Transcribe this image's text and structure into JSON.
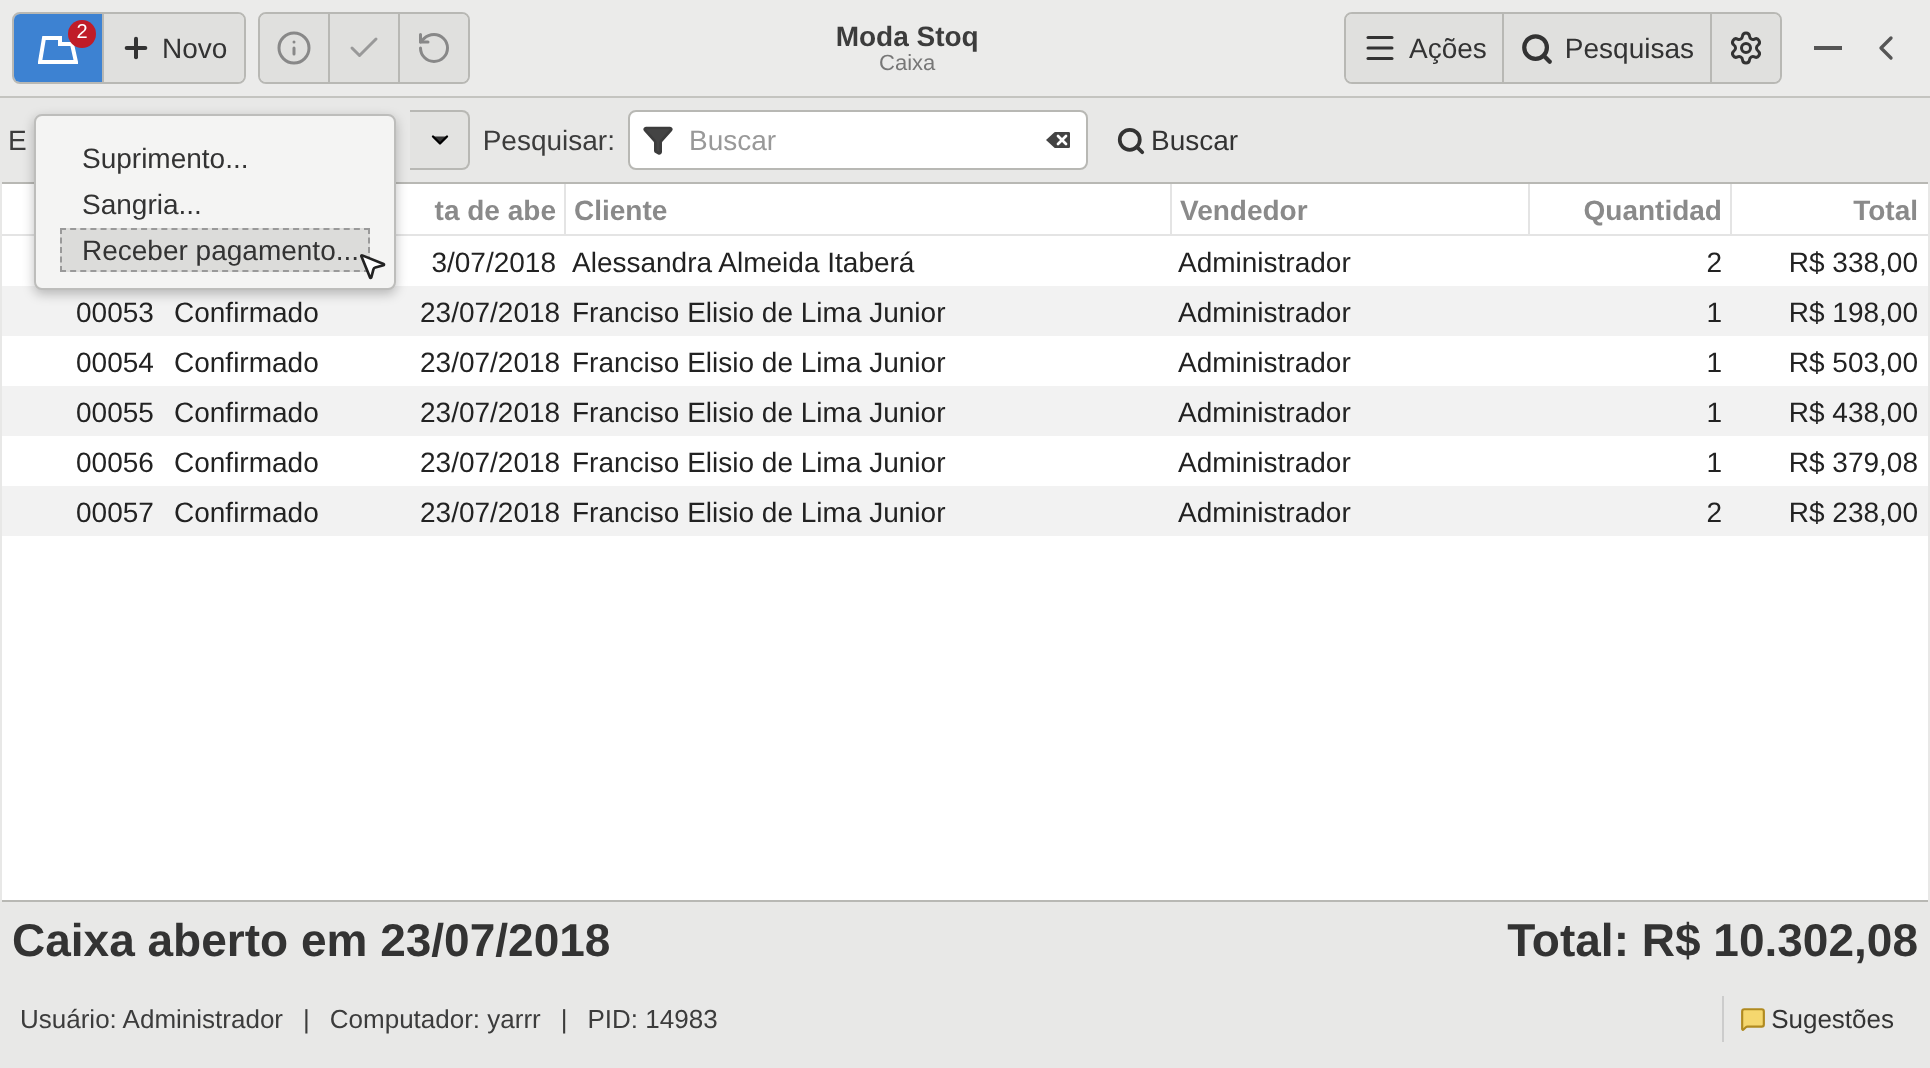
{
  "header": {
    "badge": "2",
    "new_button": "Novo",
    "title": "Moda Stoq",
    "subtitle": "Caixa",
    "actions_button": "Ações",
    "searches_button": "Pesquisas"
  },
  "filter": {
    "label": "E",
    "search_label": "Pesquisar:",
    "placeholder": "Buscar",
    "search_button": "Buscar"
  },
  "menu": {
    "items": [
      {
        "label": "Suprimento...",
        "selected": false
      },
      {
        "label": "Sangria...",
        "selected": false
      },
      {
        "label": "Receber pagamento...",
        "selected": true
      }
    ]
  },
  "table": {
    "columns": [
      {},
      {},
      {
        "label": "ta de abe"
      },
      {
        "label": "Cliente"
      },
      {
        "label": "Vendedor"
      },
      {
        "label": "Quantidad"
      },
      {
        "label": "Total"
      }
    ],
    "rows": [
      {
        "cells": [
          null,
          null,
          "3/07/2018",
          "Alessandra Almeida Itaberá",
          "Administrador",
          "2",
          "R$ 338,00"
        ]
      },
      {
        "cells": [
          "00053",
          "Confirmado",
          "23/07/2018",
          "Franciso Elisio de Lima Junior",
          "Administrador",
          "1",
          "R$ 198,00"
        ]
      },
      {
        "cells": [
          "00054",
          "Confirmado",
          "23/07/2018",
          "Franciso Elisio de Lima Junior",
          "Administrador",
          "1",
          "R$ 503,00"
        ]
      },
      {
        "cells": [
          "00055",
          "Confirmado",
          "23/07/2018",
          "Franciso Elisio de Lima Junior",
          "Administrador",
          "1",
          "R$ 438,00"
        ]
      },
      {
        "cells": [
          "00056",
          "Confirmado",
          "23/07/2018",
          "Franciso Elisio de Lima Junior",
          "Administrador",
          "1",
          "R$ 379,08"
        ]
      },
      {
        "cells": [
          "00057",
          "Confirmado",
          "23/07/2018",
          "Franciso Elisio de Lima Junior",
          "Administrador",
          "2",
          "R$ 238,00"
        ]
      }
    ]
  },
  "summary": {
    "opened": "Caixa aberto em 23/07/2018",
    "total": "Total: R$ 10.302,08"
  },
  "status_bar": {
    "user": "Usuário: Administrador",
    "computer": "Computador: yarrr",
    "pid": "PID: 14983",
    "separator": "|",
    "suggestions": "Sugestões"
  }
}
